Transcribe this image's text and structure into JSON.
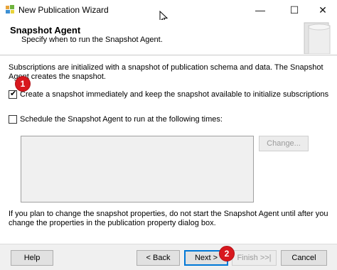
{
  "window": {
    "title": "New Publication Wizard",
    "minimize_glyph": "—",
    "maximize_glyph": "☐",
    "close_glyph": "✕",
    "app_icon": "wizard-app-icon"
  },
  "header": {
    "title": "Snapshot Agent",
    "subtitle": "Specify when to run the Snapshot Agent."
  },
  "intro_text": "Subscriptions are initialized with a snapshot of publication schema and data. The Snapshot Agent creates the snapshot.",
  "options": {
    "create_snapshot": {
      "label": "Create a snapshot immediately and keep the snapshot available to initialize subscriptions",
      "checked": true,
      "check_glyph": "✔"
    },
    "schedule": {
      "label": "Schedule the Snapshot Agent to run at the following times:",
      "checked": false
    },
    "change_button": "Change..."
  },
  "note_text": "If you plan to change the snapshot properties, do not start the Snapshot Agent until after you change the properties in the publication property dialog box.",
  "buttons": {
    "help": "Help",
    "back": "< Back",
    "next": "Next >",
    "finish": "Finish >>|",
    "cancel": "Cancel"
  },
  "annotations": {
    "step1": "1",
    "step2": "2",
    "color": "#d8181e"
  }
}
